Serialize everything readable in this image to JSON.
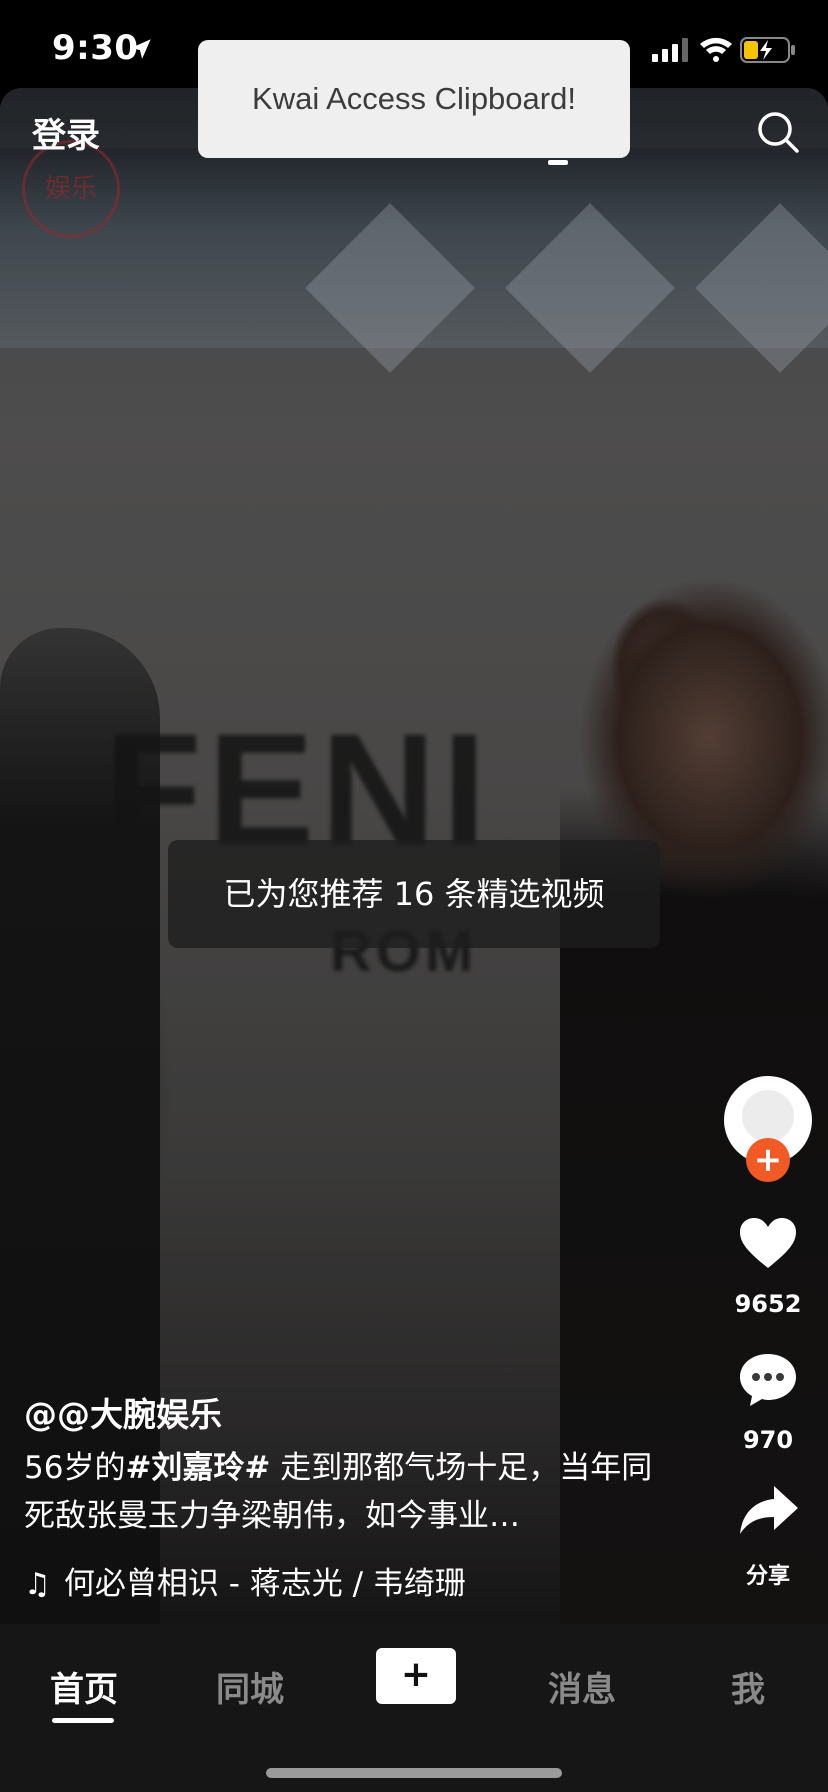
{
  "status_bar": {
    "time": "9:30"
  },
  "header": {
    "login_label": "登录",
    "search_icon": "search-icon"
  },
  "clipboard_toast": {
    "text": "Kwai Access Clipboard!"
  },
  "video": {
    "wall_text": "FENI",
    "wall_subtext": "ROM",
    "watermark_text": "娱乐"
  },
  "recommend_toast": {
    "text": "已为您推荐 16 条精选视频"
  },
  "right_rail": {
    "follow_symbol": "+",
    "like_count": "9652",
    "comment_count": "970",
    "share_label": "分享"
  },
  "post": {
    "author": "@@大腕娱乐",
    "caption_prefix": "56岁的",
    "caption_hashtag": "#刘嘉玲#",
    "caption_rest": " 走到那都气场十足，当年同死敌张曼玉力争梁朝伟，如今事业…",
    "music": "何必曾相识 - 蒋志光 / 韦绮珊"
  },
  "tab_bar": {
    "tabs": [
      {
        "label": "首页",
        "active": true
      },
      {
        "label": "同城",
        "active": false
      },
      {
        "label": "+",
        "active": false
      },
      {
        "label": "消息",
        "active": false
      },
      {
        "label": "我",
        "active": false
      }
    ]
  },
  "colors": {
    "follow_accent": "#f15a24",
    "tab_bar_bg": "#161616",
    "toast_bg": "#efefef"
  }
}
